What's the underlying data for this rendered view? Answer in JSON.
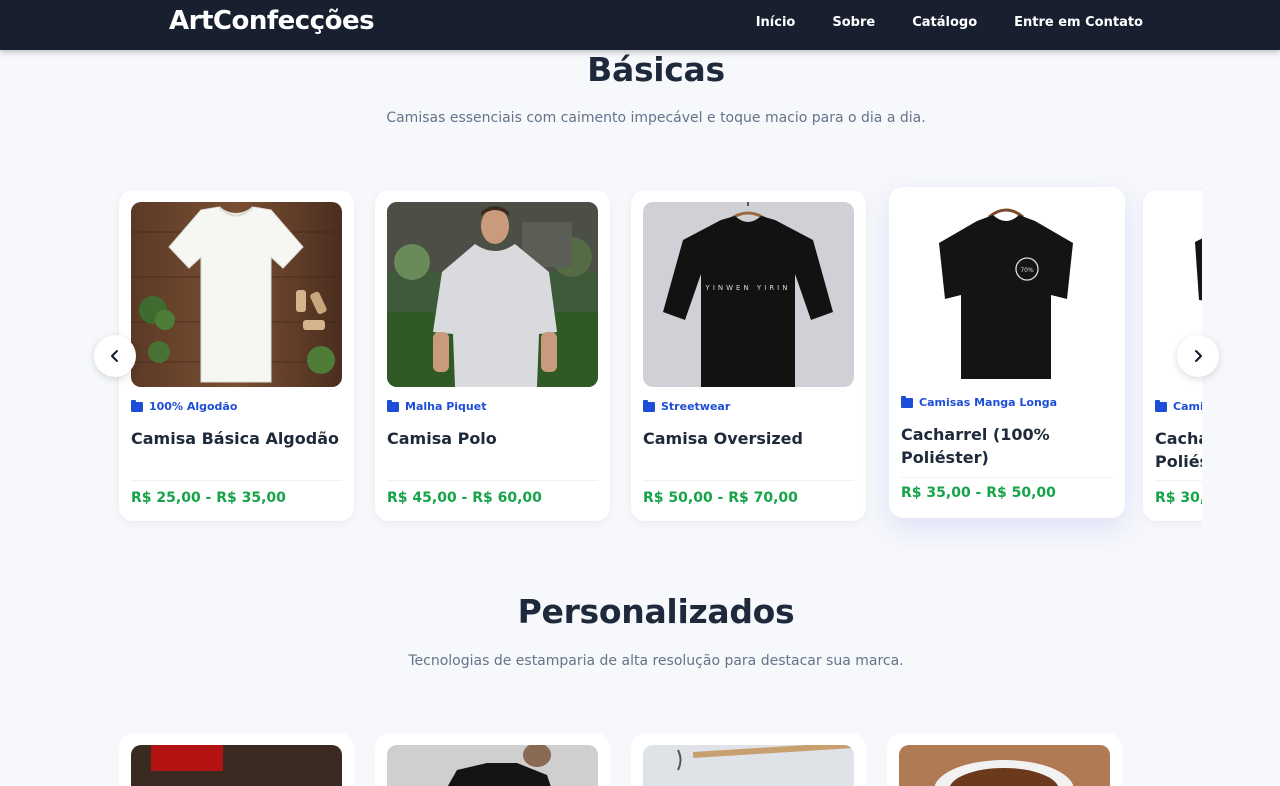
{
  "header": {
    "logo": "ArtConfecções",
    "nav": [
      "Início",
      "Sobre",
      "Catálogo",
      "Entre em Contato"
    ]
  },
  "sections": {
    "basicas": {
      "title": "Básicas",
      "subtitle": "Camisas essenciais com caimento impecável e toque macio para o dia a dia."
    },
    "personalizados": {
      "title": "Personalizados",
      "subtitle": "Tecnologias de estamparia de alta resolução para destacar sua marca."
    }
  },
  "products": [
    {
      "category": "100% Algodão",
      "title": "Camisa Básica Algodão",
      "price": "R$ 25,00 - R$ 35,00"
    },
    {
      "category": "Malha Piquet",
      "title": "Camisa Polo",
      "price": "R$ 45,00 - R$ 60,00"
    },
    {
      "category": "Streetwear",
      "title": "Camisa Oversized",
      "price": "R$ 50,00 - R$ 70,00"
    },
    {
      "category": "Camisas Manga Longa",
      "title": "Cacharrel (100% Poliéster)",
      "price": "R$ 35,00 - R$ 50,00"
    },
    {
      "category": "Camis",
      "title": "Cacha Poliést",
      "price": "R$ 30,0"
    }
  ],
  "icons": {
    "prev": "chevron-left-icon",
    "next": "chevron-right-icon",
    "category": "folder-icon"
  },
  "colors": {
    "header_bg": "#182030",
    "category": "#1d4ed8",
    "price": "#16a34a",
    "title": "#1e293b"
  }
}
